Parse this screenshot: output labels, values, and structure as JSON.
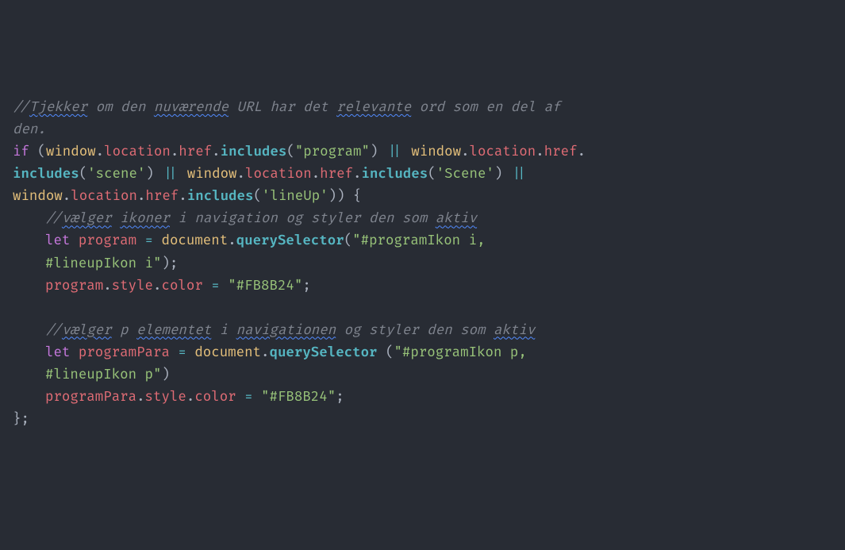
{
  "code": {
    "comment1_a": "//",
    "comment1_b": "Tjekker",
    "comment1_c": " om den ",
    "comment1_d": "nuværende",
    "comment1_e": " URL har det ",
    "comment1_f": "relevante",
    "comment1_g": " ord som en del af ",
    "comment1_h": "den.",
    "if": "if",
    "open_paren": " (",
    "window": "window",
    "dot": ".",
    "location": "location",
    "href": "href",
    "includes": "includes",
    "lp": "(",
    "rp": ")",
    "str_program": "\"program\"",
    "or": " || ",
    "str_scene_l": "'scene'",
    "str_scene_u": "'Scene'",
    "str_lineup": "'lineUp'",
    "close_cond": ") {",
    "comment2_a": "//",
    "comment2_b": "vælger",
    "comment2_c": " ",
    "comment2_d": "ikoner",
    "comment2_e": " i navigation og styler den som ",
    "comment2_f": "aktiv",
    "let": "let",
    "sp": " ",
    "varProgram": "program",
    "eq": " = ",
    "document": "document",
    "querySelector": "querySelector",
    "str_sel1a": "\"#programIkon i, ",
    "str_sel1b": "#lineupIkon i\"",
    "rp_semi": ");",
    "style": "style",
    "color": "color",
    "str_color": "\"#FB8B24\"",
    "semi": ";",
    "comment3_a": "//",
    "comment3_b": "vælger",
    "comment3_c": " p ",
    "comment3_d": "elementet",
    "comment3_e": " i ",
    "comment3_f": "navigationen",
    "comment3_g": " og styler den som ",
    "comment3_h": "aktiv",
    "varProgramPara": "programPara",
    "sp_call": " ",
    "str_sel2a": "\"#programIkon p, ",
    "str_sel2b": "#lineupIkon p\"",
    "close_brace": "};"
  }
}
